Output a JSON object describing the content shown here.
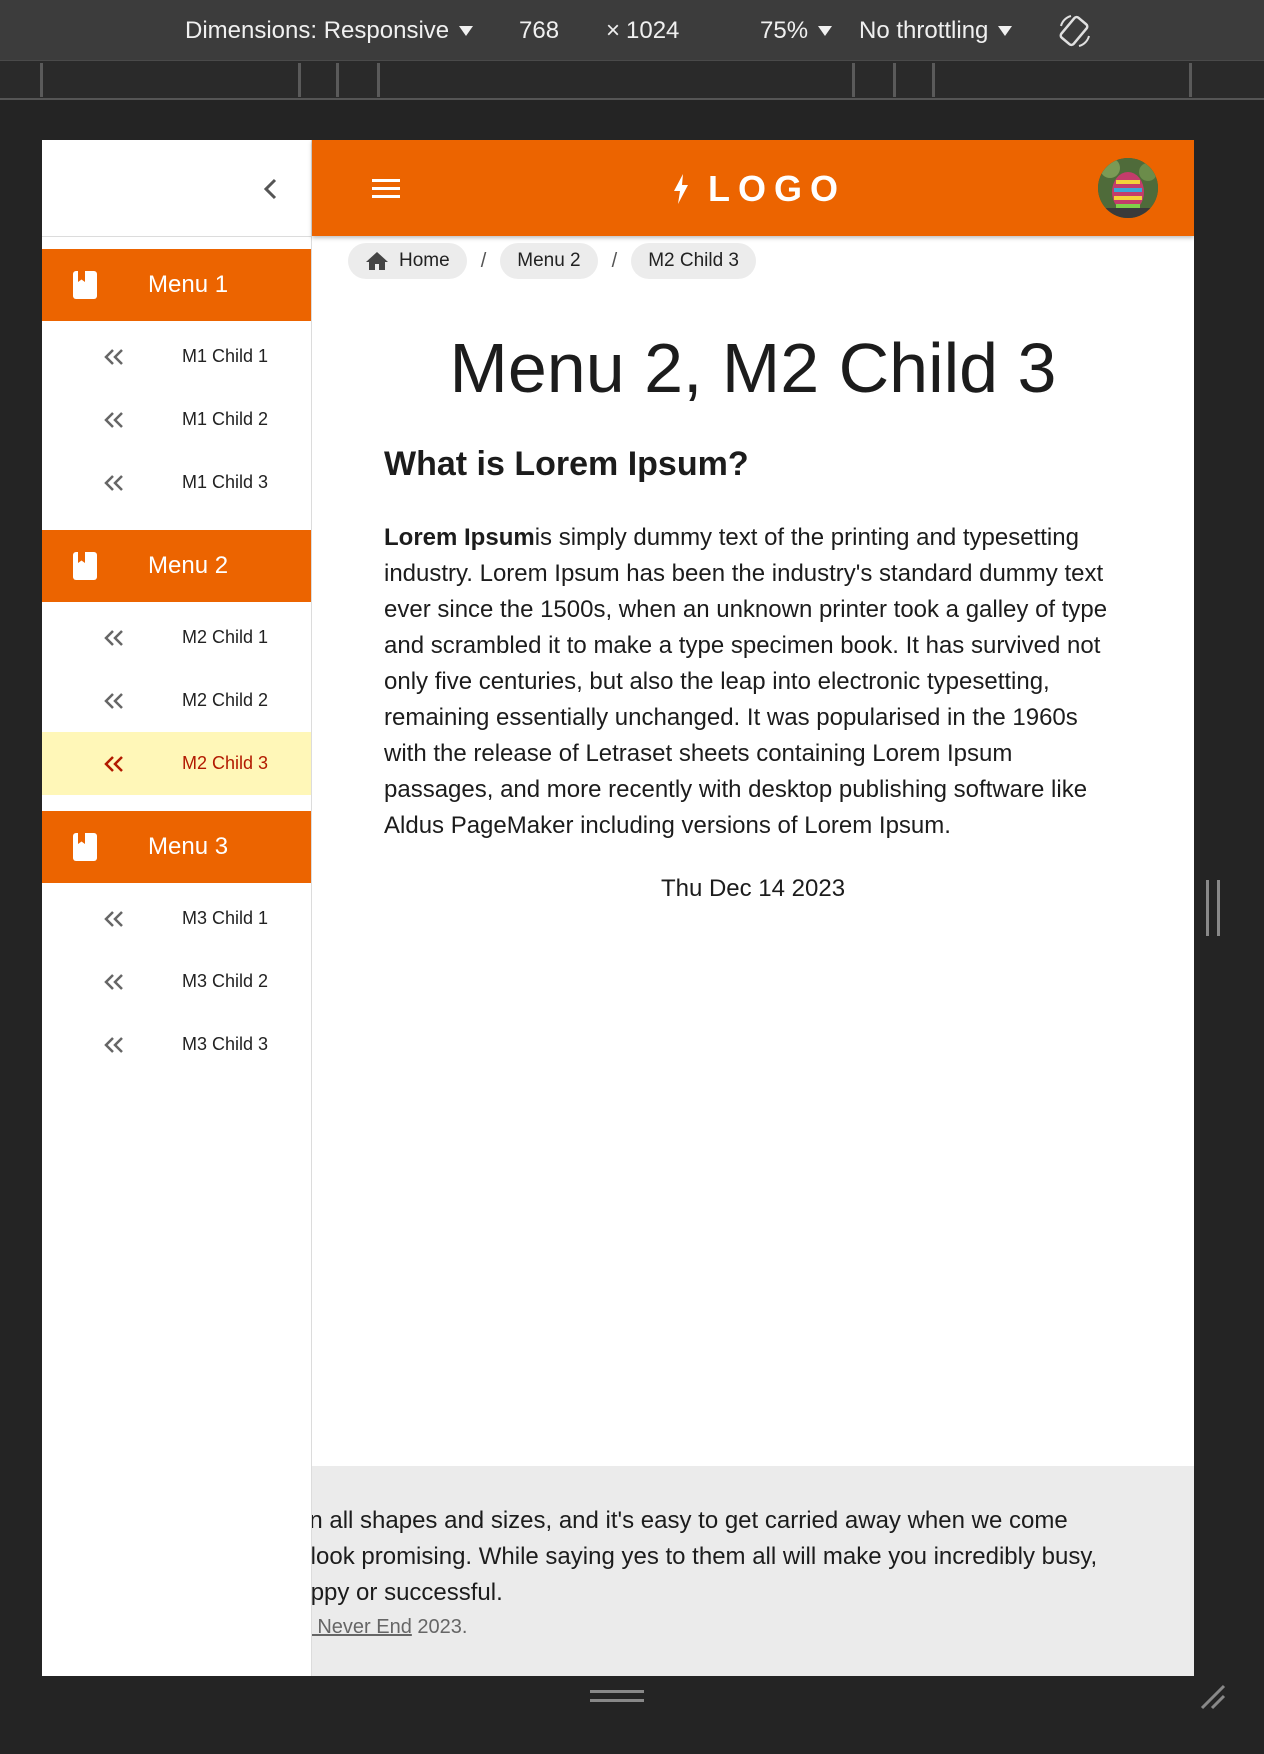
{
  "devtools": {
    "dimensions_label": "Dimensions: Responsive",
    "width": "768",
    "times": "×",
    "height": "1024",
    "zoom": "75%",
    "throttling": "No throttling",
    "rotate_icon": "rotate-icon"
  },
  "sidebar": {
    "collapse_icon": "chevron-left-icon",
    "menus": [
      {
        "label": "Menu 1",
        "icon": "bookmark-book-icon",
        "children": [
          "M1 Child 1",
          "M1 Child 2",
          "M1 Child 3"
        ]
      },
      {
        "label": "Menu 2",
        "icon": "bookmark-book-icon",
        "children": [
          "M2 Child 1",
          "M2 Child 2",
          "M2 Child 3"
        ]
      },
      {
        "label": "Menu 3",
        "icon": "bookmark-book-icon",
        "children": [
          "M3 Child 1",
          "M3 Child 2",
          "M3 Child 3"
        ]
      }
    ],
    "active_child": "M2 Child 3"
  },
  "header": {
    "menu_icon": "hamburger-icon",
    "logo_text": "LOGO",
    "logo_icon": "bolt-icon",
    "avatar": "user-avatar"
  },
  "breadcrumb": {
    "home": "Home",
    "items": [
      "Menu 2",
      "M2 Child 3"
    ],
    "separator": "/"
  },
  "main": {
    "title": "Menu 2, M2 Child 3",
    "section_heading": "What is Lorem Ipsum?",
    "para_bold": "Lorem Ipsum",
    "para_text": "is simply dummy text of the printing and typesetting industry. Lorem Ipsum has been the industry's standard dummy text ever since the 1500s, when an unknown printer took a galley of type and scrambled it to make a type specimen book. It has survived not only five centuries, but also the leap into electronic typesetting, remaining essentially unchanged. It was popularised in the 1960s with the release of Letraset sheets containing Lorem Ipsum passages, and more recently with desktop publishing software like Aldus PageMaker including versions of Lorem Ipsum.",
    "date": "Thu Dec 14 2023"
  },
  "footer": {
    "line1": "e in all shapes and sizes, and it's easy to get carried away when we come",
    "line2": "at look promising. While saying yes to them all will make you incredibly busy,",
    "line3": "happy or successful.",
    "credit_link": "am Never End",
    "credit_year": " 2023."
  },
  "colors": {
    "accent": "#ec6400",
    "active_bg": "#fff7b8",
    "active_text": "#b21a00"
  }
}
